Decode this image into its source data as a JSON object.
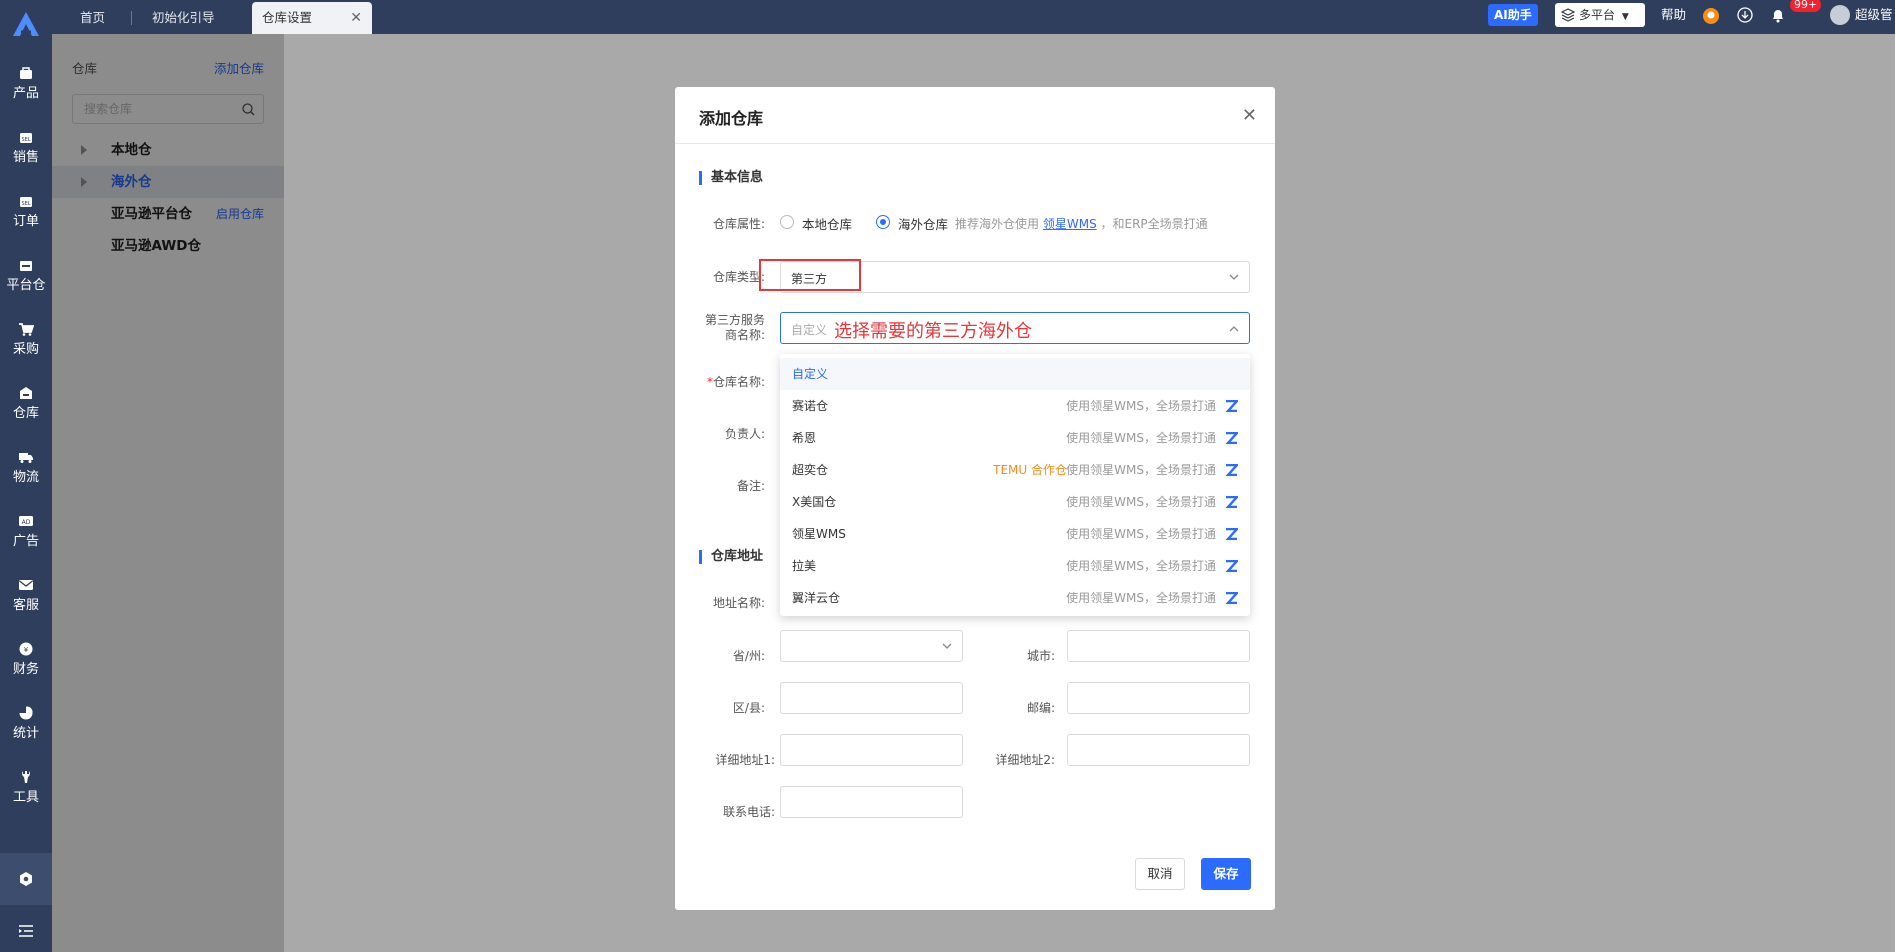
{
  "nav": {
    "items": [
      {
        "label": "产品",
        "icon": "product-icon"
      },
      {
        "label": "销售",
        "icon": "sales-icon"
      },
      {
        "label": "订单",
        "icon": "order-icon"
      },
      {
        "label": "平台仓",
        "icon": "platform-warehouse-icon"
      },
      {
        "label": "采购",
        "icon": "cart-icon"
      },
      {
        "label": "仓库",
        "icon": "warehouse-icon"
      },
      {
        "label": "物流",
        "icon": "truck-icon"
      },
      {
        "label": "广告",
        "icon": "ad-icon"
      },
      {
        "label": "客服",
        "icon": "mail-icon"
      },
      {
        "label": "财务",
        "icon": "finance-icon"
      },
      {
        "label": "统计",
        "icon": "pie-icon"
      },
      {
        "label": "工具",
        "icon": "wrench-icon"
      }
    ]
  },
  "tabs": [
    {
      "label": "首页"
    },
    {
      "label": "初始化引导"
    },
    {
      "label": "仓库设置"
    }
  ],
  "topbar": {
    "ai": "AI助手",
    "platform": "多平台",
    "help": "帮助",
    "badge": "99+",
    "user": "超级管理员"
  },
  "panel": {
    "title": "仓库",
    "add": "添加仓库",
    "search_placeholder": "搜索仓库",
    "tree": [
      {
        "label": "本地仓"
      },
      {
        "label": "海外仓"
      },
      {
        "label": "亚马逊平台仓",
        "link": "启用仓库"
      },
      {
        "label": "亚马逊AWD仓"
      }
    ]
  },
  "modal": {
    "title": "添加仓库",
    "section_basic": "基本信息",
    "attr_label": "仓库属性:",
    "local": "本地仓库",
    "overseas": "海外仓库",
    "hint_prefix": "推荐海外仓使用",
    "hint_link": "领星WMS",
    "hint_suffix": "，和ERP全场景打通",
    "type_label": "仓库类型:",
    "type_value": "第三方",
    "provider_label_1": "第三方服务",
    "provider_label_2": "商名称:",
    "provider_placeholder": "自定义",
    "annotation": "选择需要的第三方海外仓",
    "name_label": "仓库名称:",
    "owner_label": "负责人:",
    "note_label": "备注:",
    "section_address": "仓库地址",
    "addr_name_label": "地址名称:",
    "province_label": "省/州:",
    "city_label": "城市:",
    "district_label": "区/县:",
    "zip_label": "邮编:",
    "addr1_label": "详细地址1:",
    "addr2_label": "详细地址2:",
    "phone_label": "联系电话:",
    "cancel": "取消",
    "save": "保存"
  },
  "dropdown": {
    "options": [
      {
        "label": "自定义",
        "meta": "",
        "tag": ""
      },
      {
        "label": "赛诺仓",
        "meta": "使用领星WMS，全场景打通",
        "tag": ""
      },
      {
        "label": "希恩",
        "meta": "使用领星WMS，全场景打通",
        "tag": ""
      },
      {
        "label": "超奕仓",
        "meta": "使用领星WMS，全场景打通",
        "tag": "TEMU 合作仓"
      },
      {
        "label": "X美国仓",
        "meta": "使用领星WMS，全场景打通",
        "tag": ""
      },
      {
        "label": "领星WMS",
        "meta": "使用领星WMS，全场景打通",
        "tag": ""
      },
      {
        "label": "拉美",
        "meta": "使用领星WMS，全场景打通",
        "tag": ""
      },
      {
        "label": "翼洋云仓",
        "meta": "使用领星WMS，全场景打通",
        "tag": ""
      }
    ]
  },
  "colors": {
    "accent": "#2b6bff",
    "nav_bg": "#2f3e5c",
    "annotation": "#e8363b",
    "tag": "#fa8c16"
  }
}
